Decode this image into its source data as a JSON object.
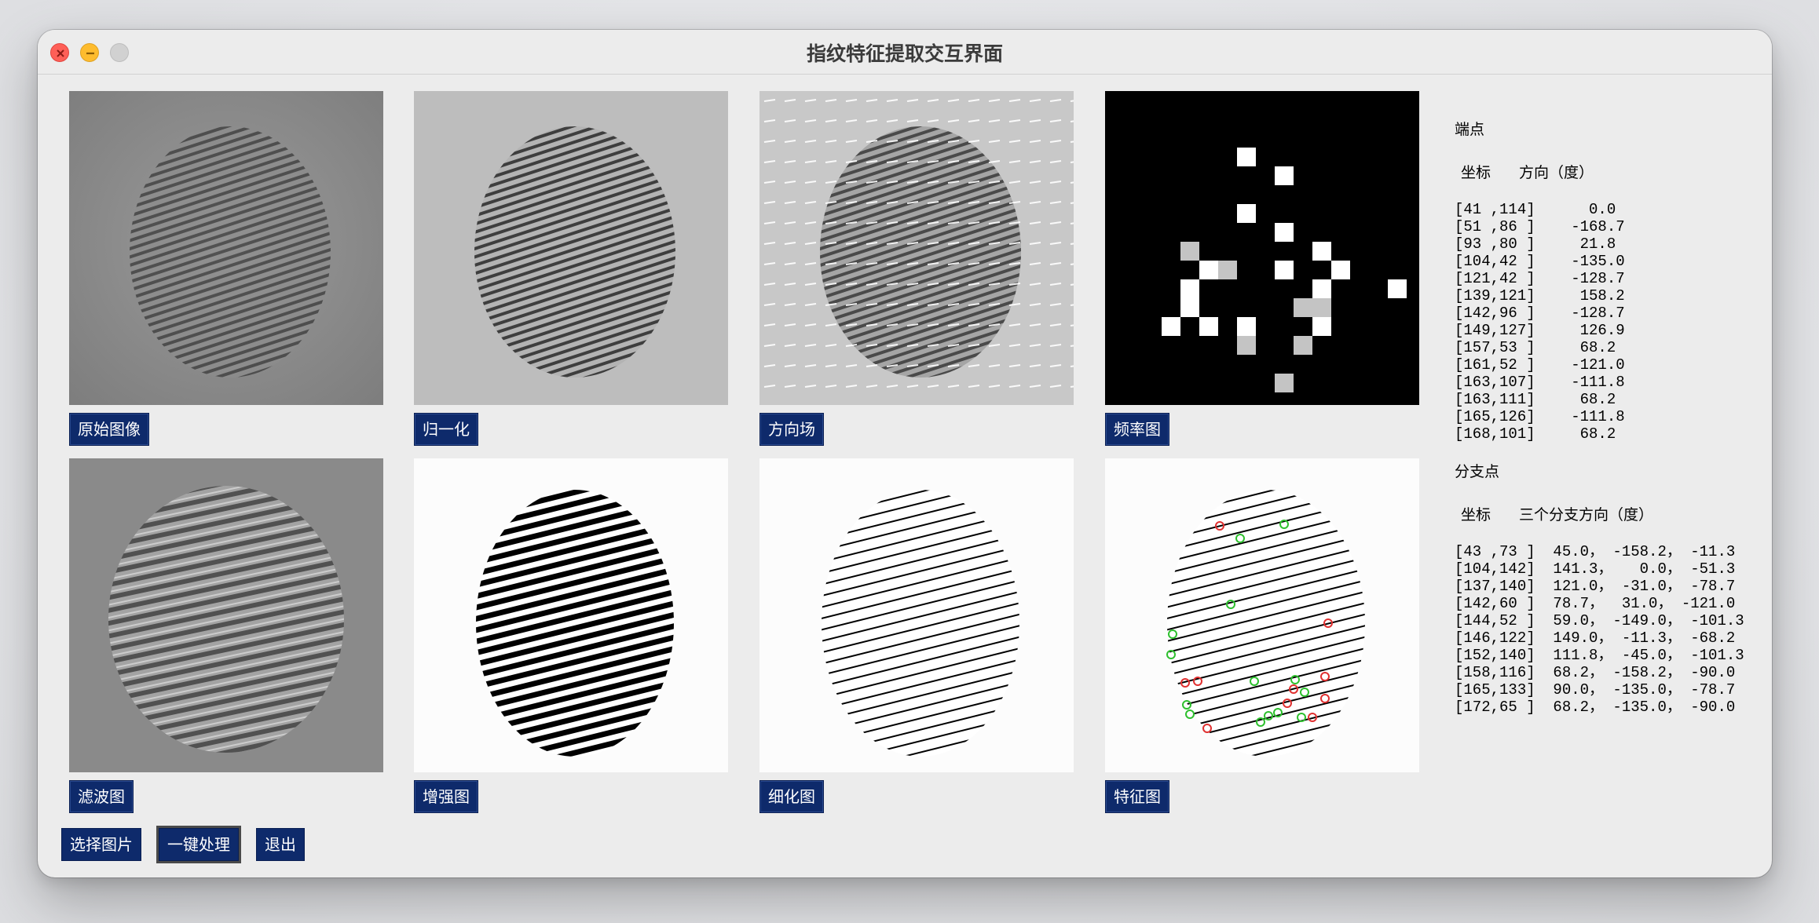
{
  "window": {
    "title": "指纹特征提取交互界面"
  },
  "panels": [
    {
      "label": "原始图像"
    },
    {
      "label": "归一化"
    },
    {
      "label": "方向场"
    },
    {
      "label": "频率图"
    },
    {
      "label": "滤波图"
    },
    {
      "label": "增强图"
    },
    {
      "label": "细化图"
    },
    {
      "label": "特征图"
    }
  ],
  "actions": {
    "select": "选择图片",
    "process": "一键处理",
    "exit": "退出"
  },
  "endpoints": {
    "heading": "端点",
    "col_coord": "坐标",
    "col_dir": "方向（度）",
    "rows": [
      "[41 ,114]      0.0",
      "[51 ,86 ]    -168.7",
      "[93 ,80 ]     21.8",
      "[104,42 ]    -135.0",
      "[121,42 ]    -128.7",
      "[139,121]     158.2",
      "[142,96 ]    -128.7",
      "[149,127]     126.9",
      "[157,53 ]     68.2",
      "[161,52 ]    -121.0",
      "[163,107]    -111.8",
      "[163,111]     68.2",
      "[165,126]    -111.8",
      "[168,101]     68.2"
    ]
  },
  "branches": {
    "heading": "分支点",
    "col_coord": "坐标",
    "col_dir": "三个分支方向（度）",
    "rows": [
      "[43 ,73 ]  45.0， -158.2， -11.3",
      "[104,142]  141.3，   0.0， -51.3",
      "[137,140]  121.0， -31.0， -78.7",
      "[142,60 ]  78.7，  31.0， -121.0",
      "[144,52 ]  59.0， -149.0， -101.3",
      "[146,122]  149.0， -11.3， -68.2",
      "[152,140]  111.8， -45.0， -101.3",
      "[158,116]  68.2， -158.2， -90.0",
      "[165,133]  90.0， -135.0， -78.7",
      "[172,65 ]  68.2， -135.0， -90.0"
    ]
  },
  "colors": {
    "button_bg": "#0e2a6b",
    "endpoint_marker": "#e03030",
    "branch_marker": "#2ec02e"
  }
}
